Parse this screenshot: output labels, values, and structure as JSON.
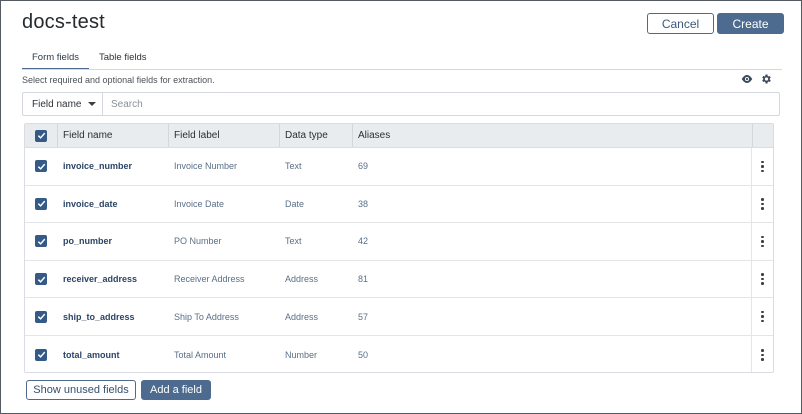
{
  "header": {
    "title": "docs-test",
    "cancel_label": "Cancel",
    "create_label": "Create"
  },
  "tabs": [
    {
      "label": "Form fields",
      "active": true
    },
    {
      "label": "Table fields",
      "active": false
    }
  ],
  "hint": "Select required and optional fields for extraction.",
  "icons": {
    "eye": "eye-icon",
    "settings": "gear-icon"
  },
  "search": {
    "field_selected": "Field name",
    "placeholder": "Search"
  },
  "table": {
    "columns": [
      "Field name",
      "Field label",
      "Data type",
      "Aliases"
    ],
    "select_all_checked": true,
    "rows": [
      {
        "name": "invoice_number",
        "label": "Invoice Number",
        "type": "Text",
        "aliases": "69",
        "checked": true
      },
      {
        "name": "invoice_date",
        "label": "Invoice Date",
        "type": "Date",
        "aliases": "38",
        "checked": true
      },
      {
        "name": "po_number",
        "label": "PO Number",
        "type": "Text",
        "aliases": "42",
        "checked": true
      },
      {
        "name": "receiver_address",
        "label": "Receiver Address",
        "type": "Address",
        "aliases": "81",
        "checked": true
      },
      {
        "name": "ship_to_address",
        "label": "Ship To Address",
        "type": "Address",
        "aliases": "57",
        "checked": true
      },
      {
        "name": "total_amount",
        "label": "Total Amount",
        "type": "Number",
        "aliases": "50",
        "checked": true
      }
    ]
  },
  "footer": {
    "show_unused_label": "Show unused fields",
    "add_field_label": "Add a field"
  },
  "colors": {
    "primary": "#4d6b8f",
    "checkbox": "#355a86",
    "header_bg": "#e9ecee"
  }
}
